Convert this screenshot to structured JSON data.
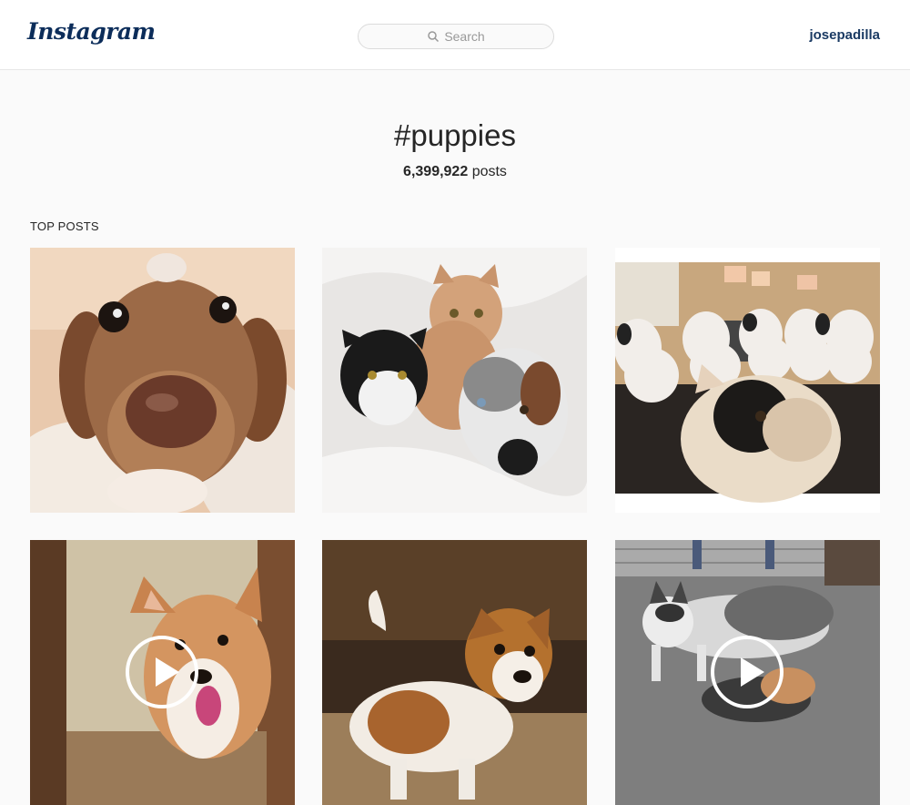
{
  "header": {
    "logo_text": "Instagram",
    "search_placeholder": "Search",
    "username": "josepadilla"
  },
  "tag": {
    "name": "#puppies",
    "post_count": "6,399,922",
    "post_count_suffix": "posts"
  },
  "section": {
    "title": "TOP POSTS"
  },
  "posts": [
    {
      "subject": "dachshund puppy close-up",
      "is_video": false
    },
    {
      "subject": "two cats and a dog in blankets",
      "is_video": false
    },
    {
      "subject": "french bulldog with plush toys",
      "is_video": false
    },
    {
      "subject": "corgi puppy",
      "is_video": true
    },
    {
      "subject": "jack russell puppy",
      "is_video": false
    },
    {
      "subject": "husky and puppy playing",
      "is_video": true
    }
  ],
  "icons": {
    "search": "search-icon",
    "play": "play-icon"
  },
  "colors": {
    "logo": "#0c2d5a",
    "username": "#1a3a63",
    "background": "#fafafa"
  }
}
